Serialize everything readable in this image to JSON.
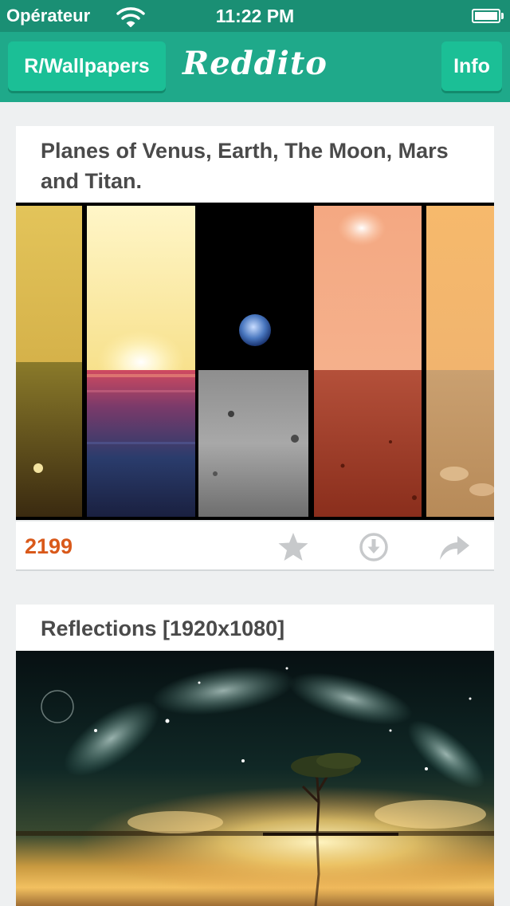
{
  "status_bar": {
    "carrier": "Opérateur",
    "time": "11:22 PM",
    "wifi_icon": "wifi-icon",
    "battery_icon": "battery-icon"
  },
  "nav": {
    "left_button": "R/Wallpapers",
    "title": "Reddito",
    "right_button": "Info"
  },
  "posts": [
    {
      "title": "Planes of Venus, Earth, The Moon, Mars and Titan.",
      "score": "2199",
      "actions": [
        "star-icon",
        "download-icon",
        "share-icon"
      ],
      "colors": {
        "score": "#d9591a",
        "icon": "#c7c9cb"
      }
    },
    {
      "title": "Reflections [1920x1080]"
    }
  ],
  "colors": {
    "statusbar": "#1a8f74",
    "navbar": "#1fa98a",
    "button": "#1bbf96",
    "background": "#eef0f1"
  }
}
